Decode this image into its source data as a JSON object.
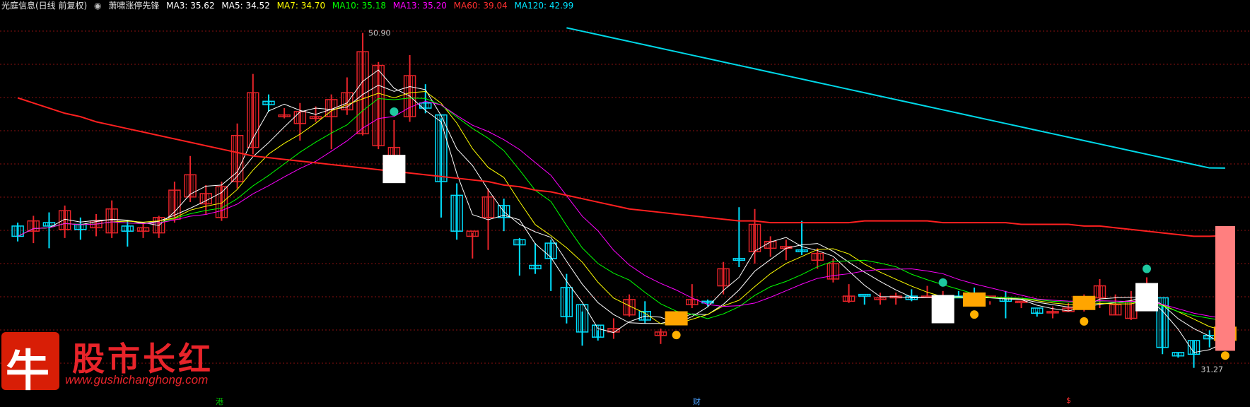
{
  "header": {
    "stock_label": "光庭信息(日线 前复权)",
    "indicator_name": "萧啸涨停先锋",
    "ma": [
      {
        "label": "MA3: 35.62",
        "color": "#ffffff"
      },
      {
        "label": "MA5: 34.52",
        "color": "#ffffff"
      },
      {
        "label": "MA7: 34.70",
        "color": "#ffff00"
      },
      {
        "label": "MA10: 35.18",
        "color": "#00ff00"
      },
      {
        "label": "MA13: 35.20",
        "color": "#ff00ff"
      },
      {
        "label": "MA60: 39.04",
        "color": "#ff2020"
      },
      {
        "label": "MA120: 42.99",
        "color": "#00e5ff"
      }
    ]
  },
  "logo": {
    "glyph": "牛",
    "name": "股市长红",
    "url": "www.gushichanghong.com"
  },
  "markers": [
    {
      "text": "港",
      "color": "#00c000"
    },
    {
      "text": "财",
      "color": "#4aa0ff"
    },
    {
      "text": "$",
      "color": "#ff3030"
    }
  ],
  "colors": {
    "up": "#e8242a",
    "down": "#00e0ff",
    "grid": "#8a1010",
    "ma60": "#ff2020",
    "ma120": "#00d8e8"
  },
  "chart_data": {
    "type": "candlestick",
    "ylim": [
      30.5,
      52.0
    ],
    "high_label": "50.90",
    "low_label": "31.27",
    "candles": [
      [
        39.6,
        39.8,
        38.7,
        39.0
      ],
      [
        39.3,
        40.2,
        38.6,
        39.9
      ],
      [
        39.8,
        40.4,
        38.3,
        39.6
      ],
      [
        39.4,
        40.8,
        38.9,
        40.5
      ],
      [
        39.7,
        40.1,
        38.8,
        39.4
      ],
      [
        39.5,
        40.3,
        39.0,
        39.9
      ],
      [
        39.2,
        41.1,
        38.9,
        40.6
      ],
      [
        39.6,
        39.9,
        38.4,
        39.3
      ],
      [
        39.3,
        39.8,
        38.9,
        39.5
      ],
      [
        39.2,
        40.2,
        38.9,
        40.1
      ],
      [
        40.0,
        42.2,
        39.8,
        41.7
      ],
      [
        41.3,
        43.7,
        41.0,
        42.6
      ],
      [
        40.9,
        42.0,
        40.3,
        41.5
      ],
      [
        40.1,
        42.2,
        39.9,
        41.9
      ],
      [
        42.2,
        45.6,
        41.8,
        44.9
      ],
      [
        44.2,
        48.5,
        43.8,
        47.4
      ],
      [
        46.9,
        47.3,
        46.3,
        46.7
      ],
      [
        46.0,
        46.5,
        45.9,
        46.1
      ],
      [
        45.6,
        46.8,
        44.6,
        46.3
      ],
      [
        45.9,
        46.6,
        45.7,
        46.0
      ],
      [
        46.0,
        47.3,
        44.1,
        47.0
      ],
      [
        46.4,
        48.3,
        46.1,
        47.4
      ],
      [
        45.0,
        50.9,
        44.9,
        49.8
      ],
      [
        44.3,
        49.2,
        44.1,
        49.0
      ],
      [
        43.6,
        45.8,
        43.3,
        44.2
      ],
      [
        46.0,
        49.6,
        45.7,
        48.4
      ],
      [
        46.8,
        47.9,
        46.2,
        46.5
      ],
      [
        46.1,
        45.9,
        40.1,
        42.2
      ],
      [
        41.4,
        42.1,
        38.8,
        39.3
      ],
      [
        39.0,
        39.2,
        37.7,
        39.3
      ],
      [
        40.1,
        41.8,
        38.2,
        41.3
      ],
      [
        40.8,
        41.2,
        39.3,
        40.1
      ],
      [
        38.8,
        38.9,
        36.7,
        38.5
      ],
      [
        37.3,
        38.6,
        36.8,
        37.1
      ],
      [
        38.6,
        38.8,
        35.8,
        37.7
      ],
      [
        36.0,
        36.8,
        33.9,
        34.3
      ],
      [
        35.0,
        34.6,
        32.6,
        33.4
      ],
      [
        33.8,
        33.5,
        32.9,
        33.1
      ],
      [
        33.4,
        34.2,
        33.0,
        33.6
      ],
      [
        34.4,
        35.6,
        34.3,
        35.3
      ],
      [
        34.6,
        35.2,
        33.9,
        34.1
      ],
      [
        33.2,
        33.6,
        32.7,
        33.4
      ],
      [
        34.1,
        34.5,
        33.8,
        34.2
      ],
      [
        35.0,
        36.2,
        34.8,
        35.3
      ],
      [
        35.2,
        35.3,
        34.9,
        35.1
      ],
      [
        36.1,
        37.5,
        35.6,
        37.1
      ],
      [
        37.7,
        40.7,
        37.2,
        37.6
      ],
      [
        38.1,
        40.6,
        37.4,
        39.7
      ],
      [
        38.3,
        39.0,
        37.8,
        38.7
      ],
      [
        38.3,
        38.8,
        37.6,
        38.4
      ],
      [
        38.2,
        39.9,
        37.9,
        38.1
      ],
      [
        37.6,
        38.3,
        37.1,
        38.0
      ],
      [
        36.5,
        37.7,
        36.3,
        37.4
      ],
      [
        35.2,
        36.2,
        35.1,
        35.5
      ],
      [
        35.6,
        35.5,
        35.0,
        35.5
      ],
      [
        35.3,
        35.7,
        35.0,
        35.4
      ],
      [
        35.4,
        35.7,
        35.0,
        35.5
      ],
      [
        35.5,
        35.9,
        35.2,
        35.3
      ],
      [
        35.5,
        36.1,
        35.5,
        35.5
      ],
      [
        35.4,
        35.8,
        35.2,
        35.5
      ],
      [
        35.5,
        35.8,
        35.5,
        35.4
      ],
      [
        35.6,
        36.0,
        35.0,
        35.3
      ],
      [
        35.5,
        35.2,
        35.0,
        35.5
      ],
      [
        35.4,
        35.8,
        34.2,
        35.2
      ],
      [
        35.2,
        35.1,
        34.8,
        35.2
      ],
      [
        34.8,
        34.6,
        34.3,
        34.5
      ],
      [
        34.6,
        34.9,
        34.2,
        34.6
      ],
      [
        34.6,
        35.1,
        34.6,
        34.8
      ],
      [
        35.1,
        35.6,
        34.6,
        35.1
      ],
      [
        35.4,
        36.5,
        34.8,
        36.1
      ],
      [
        34.4,
        35.6,
        34.4,
        35.0
      ],
      [
        34.2,
        35.8,
        34.1,
        35.2
      ],
      [
        36.1,
        36.6,
        35.0,
        36.2
      ],
      [
        35.4,
        35.0,
        32.1,
        32.5
      ],
      [
        32.2,
        32.2,
        31.9,
        32.0
      ],
      [
        32.9,
        32.9,
        31.3,
        32.1
      ],
      [
        33.2,
        33.5,
        32.5,
        33.0
      ],
      [
        33.4,
        33.6,
        32.6,
        33.3
      ]
    ],
    "ma60": [
      47.1,
      46.8,
      46.5,
      46.2,
      46.0,
      45.7,
      45.5,
      45.3,
      45.1,
      44.9,
      44.7,
      44.5,
      44.3,
      44.1,
      43.9,
      43.7,
      43.6,
      43.5,
      43.4,
      43.3,
      43.2,
      43.1,
      43.0,
      42.9,
      42.8,
      42.7,
      42.6,
      42.5,
      42.4,
      42.3,
      42.2,
      42.0,
      41.9,
      41.7,
      41.6,
      41.4,
      41.2,
      41.0,
      40.8,
      40.6,
      40.5,
      40.4,
      40.3,
      40.2,
      40.1,
      40.0,
      39.9,
      39.9,
      39.8,
      39.8,
      39.8,
      39.8,
      39.8,
      39.8,
      39.9,
      39.9,
      39.9,
      39.9,
      39.9,
      39.8,
      39.8,
      39.8,
      39.8,
      39.8,
      39.7,
      39.7,
      39.7,
      39.7,
      39.6,
      39.6,
      39.5,
      39.4,
      39.3,
      39.2,
      39.1,
      39.0,
      39.0,
      39.04
    ],
    "ma120": [
      51.2,
      51.0,
      50.8,
      50.6,
      50.4,
      50.2,
      50.0,
      49.8,
      49.6,
      49.4,
      49.2,
      49.0,
      48.8,
      48.6,
      48.4,
      48.2,
      48.0,
      47.8,
      47.6,
      47.4,
      47.2,
      47.0,
      46.8,
      46.6,
      46.4,
      46.2,
      46.0,
      45.8,
      45.6,
      45.4,
      45.2,
      45.0,
      44.8,
      44.6,
      44.4,
      44.2,
      44.0,
      43.8,
      43.6,
      43.4,
      43.2,
      43.0,
      42.99
    ],
    "signals": [
      {
        "i": 24,
        "kind": "down"
      },
      {
        "i": 42,
        "kind": "up"
      },
      {
        "i": 59,
        "kind": "down"
      },
      {
        "i": 61,
        "kind": "up"
      },
      {
        "i": 68,
        "kind": "up"
      },
      {
        "i": 72,
        "kind": "down"
      },
      {
        "i": 77,
        "kind": "up"
      }
    ]
  }
}
